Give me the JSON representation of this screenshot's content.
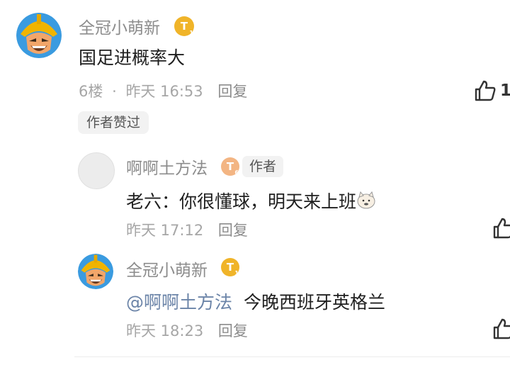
{
  "comment": {
    "username": "全冠小萌新",
    "badge": "T",
    "badge_level": "1",
    "text": "国足进概率大",
    "floor": "6楼",
    "separator": "·",
    "time": "昨天 16:53",
    "reply_label": "回复",
    "likes": "1",
    "author_liked_tag": "作者赞过"
  },
  "replies": [
    {
      "username": "啊啊土方法",
      "badge": "T",
      "badge_level": "6",
      "author_tag": "作者",
      "text": "老六：你很懂球，明天来上班",
      "emoji": "doge-emoji-icon",
      "time": "昨天 17:12",
      "reply_label": "回复"
    },
    {
      "username": "全冠小萌新",
      "badge": "T",
      "badge_level": "1",
      "mention": "@啊啊土方法",
      "text": "今晚西班牙英格兰",
      "time": "昨天 18:23",
      "reply_label": "回复"
    }
  ],
  "colors": {
    "badge_gold": "#f0b429",
    "badge_peach": "#f3b583",
    "meta": "#a6a6a6",
    "name": "#8c8c8c"
  }
}
